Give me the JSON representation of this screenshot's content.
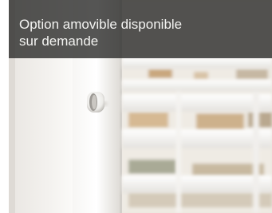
{
  "caption": {
    "text": "Option amovible disponible\nsur demande"
  },
  "photo": {
    "subject": "white-cabinet-door-with-knob-and-slatted-gate"
  }
}
